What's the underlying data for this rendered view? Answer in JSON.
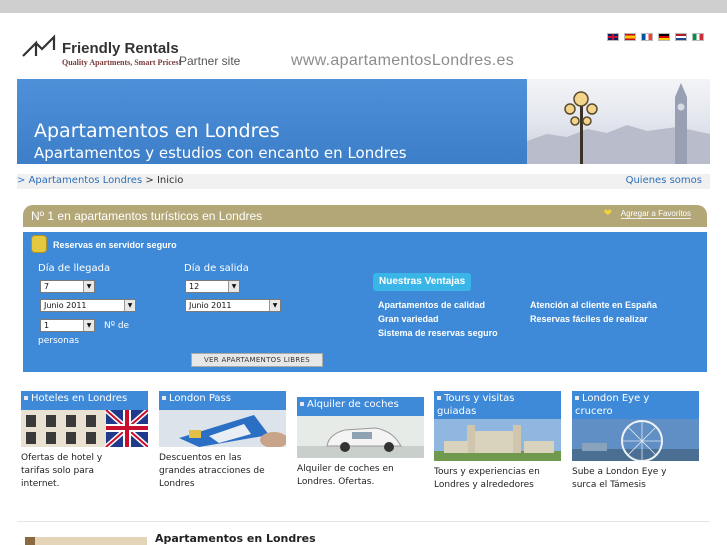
{
  "header": {
    "brand": "Friendly Rentals",
    "tagline": "Quality Apartments, Smart Prices!",
    "partner": "Partner site",
    "domain": "www.apartamentosLondres.es",
    "flags": [
      "english-flag-icon",
      "spanish-flag-icon",
      "french-flag-icon",
      "german-flag-icon",
      "dutch-flag-icon",
      "italian-flag-icon"
    ]
  },
  "banner": {
    "title": "Apartamentos en Londres",
    "subtitle": "Apartamentos y estudios con encanto en Londres"
  },
  "breadcrumb": {
    "prefix": ">",
    "link": "Apartamentos Londres",
    "separator": ">",
    "current": "Inicio",
    "about": "Quienes somos"
  },
  "promo": {
    "text": "Nº 1 en apartamentos turísticos en Londres",
    "favorites": "Agregar a Favoritos"
  },
  "booking": {
    "secure_label": "Reservas en servidor seguro",
    "arrival_label": "Día de llegada",
    "departure_label": "Día de salida",
    "arrival_day": "7",
    "arrival_month": "Junio 2011",
    "departure_day": "12",
    "departure_month": "Junio 2011",
    "persons_value": "1",
    "persons_label_1": "Nº de",
    "persons_label_2": "personas",
    "search_button": "VER APARTAMENTOS LIBRES",
    "advantages_title": "Nuestras Ventajas",
    "advantages": [
      "Apartamentos de calidad",
      "Gran variedad",
      "Sistema de reservas seguro",
      "Atención al cliente en España",
      "Reservas fáciles de realizar"
    ]
  },
  "cards": [
    {
      "title": "Hoteles en Londres",
      "desc": [
        "Ofertas de hotel y",
        "tarifas solo para",
        "internet."
      ]
    },
    {
      "title": "London Pass",
      "desc": [
        "Descuentos en las",
        "grandes atracciones de",
        "Londres"
      ]
    },
    {
      "title": "Alquiler de coches",
      "desc": [
        "Alquiler de coches en",
        "Londres. Ofertas."
      ]
    },
    {
      "title": "Tours y visitas",
      "title2": "guiadas",
      "desc": [
        "Tours y experiencias en",
        "Londres y alrededores"
      ]
    },
    {
      "title": "London Eye y",
      "title2": "crucero",
      "desc": [
        "Sube a London Eye y",
        "surca el Támesis"
      ]
    }
  ],
  "section": {
    "title": "Apartamentos en Londres"
  },
  "colors": {
    "banner_blue": "#4e90d9",
    "booking_blue": "#3f8ad8",
    "olive": "#b3a777",
    "advantage_tab": "#39b6e7"
  }
}
